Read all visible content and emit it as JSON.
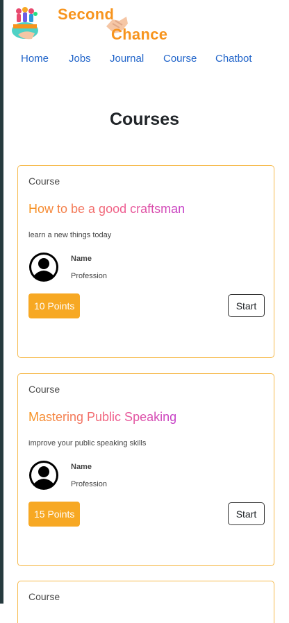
{
  "brand": {
    "line1": "Second",
    "line2": "Chance",
    "logo_icon": "people-bowl-logo-icon",
    "accent_color": "#f7941d"
  },
  "nav": {
    "items": [
      {
        "label": "Home"
      },
      {
        "label": "Jobs"
      },
      {
        "label": "Journal"
      },
      {
        "label": "Course"
      },
      {
        "label": "Chatbot"
      }
    ],
    "link_color": "#1f63c9"
  },
  "page": {
    "title": "Courses"
  },
  "courses": [
    {
      "type": "Course",
      "title": "How to be a good craftsman",
      "description": "learn a new things today",
      "author_name": "Name",
      "author_profession": "Profession",
      "points": "10 Points",
      "start_label": "Start"
    },
    {
      "type": "Course",
      "title": "Mastering Public Speaking",
      "description": "improve your public speaking skills",
      "author_name": "Name",
      "author_profession": "Profession",
      "points": "15 Points",
      "start_label": "Start"
    },
    {
      "type": "Course"
    }
  ],
  "colors": {
    "card_border": "#f6b94a",
    "points_badge": "#f7a823",
    "title_gradient_start": "#f7941d",
    "title_gradient_end": "#c43fc9"
  }
}
